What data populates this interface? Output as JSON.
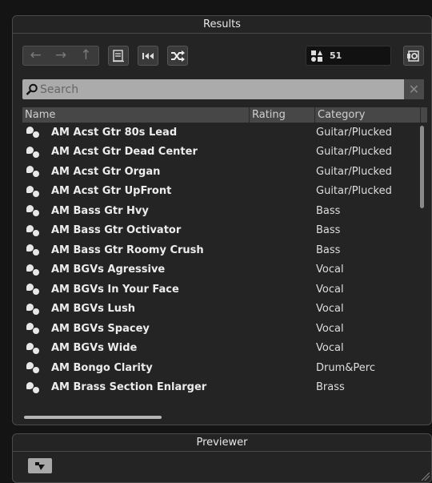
{
  "results": {
    "title": "Results",
    "count": "51",
    "search_placeholder": "Search",
    "columns": {
      "name": "Name",
      "rating": "Rating",
      "category": "Category"
    },
    "rows": [
      {
        "name": "AM Acst Gtr 80s Lead",
        "category": "Guitar/Plucked"
      },
      {
        "name": "AM Acst Gtr Dead Center",
        "category": "Guitar/Plucked"
      },
      {
        "name": "AM Acst Gtr Organ",
        "category": "Guitar/Plucked"
      },
      {
        "name": "AM Acst Gtr UpFront",
        "category": "Guitar/Plucked"
      },
      {
        "name": "AM Bass Gtr Hvy",
        "category": "Bass"
      },
      {
        "name": "AM Bass Gtr Octivator",
        "category": "Bass"
      },
      {
        "name": "AM Bass Gtr Roomy Crush",
        "category": "Bass"
      },
      {
        "name": "AM BGVs Agressive",
        "category": "Vocal"
      },
      {
        "name": "AM BGVs In Your Face",
        "category": "Vocal"
      },
      {
        "name": "AM BGVs Lush",
        "category": "Vocal"
      },
      {
        "name": "AM BGVs Spacey",
        "category": "Vocal"
      },
      {
        "name": "AM BGVs Wide",
        "category": "Vocal"
      },
      {
        "name": "AM Bongo Clarity",
        "category": "Drum&Perc"
      },
      {
        "name": "AM Brass Section Enlarger",
        "category": "Brass"
      }
    ]
  },
  "previewer": {
    "title": "Previewer"
  }
}
